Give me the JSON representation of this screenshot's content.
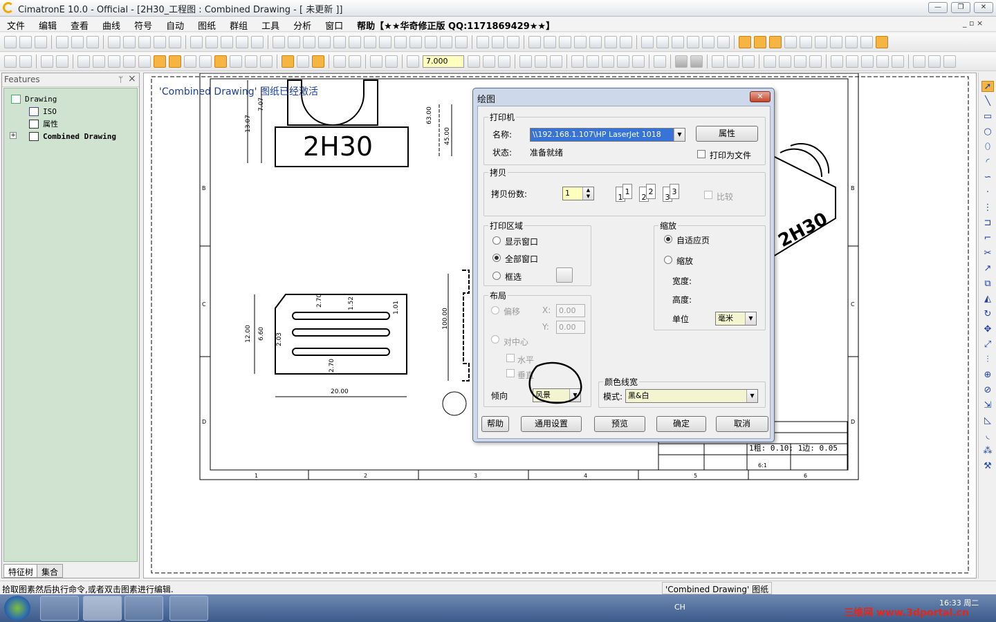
{
  "window": {
    "title": "CimatronE 10.0 - Official - [2H30_工程图 : Combined Drawing - [ 未更新 ]]",
    "min": "—",
    "max": "❐",
    "close": "✕"
  },
  "menubar": {
    "items": [
      "文件",
      "编辑",
      "查看",
      "曲线",
      "符号",
      "自动",
      "图纸",
      "群组",
      "工具",
      "分析",
      "窗口",
      "帮助【★★华奇修正版 QQ:1171869429★★】"
    ],
    "mdi_controls": "_ ▫ ×"
  },
  "toolbar": {
    "zoom_value": "7.000"
  },
  "left_panel": {
    "header": "Features",
    "pin": "ᛘ",
    "close": "×",
    "tree": [
      {
        "label": "Drawing"
      },
      {
        "label": "ISO"
      },
      {
        "label": "属性"
      },
      {
        "label": "Combined Drawing"
      }
    ],
    "expander": "+",
    "tabs": [
      "特征树",
      "集合"
    ]
  },
  "canvas": {
    "message": "'Combined Drawing' 图纸已经激活",
    "part_label": "2H30",
    "iso_label": "2H30",
    "dims": [
      "7.07",
      "13.07",
      "63.00",
      "45.00",
      "12.00",
      "6.60",
      "2.03",
      "2.70",
      "1.52",
      "1.01",
      "2.70",
      "20.00",
      "100.00"
    ],
    "row_labels": [
      "B",
      "C",
      "D"
    ],
    "col_labels": [
      "1",
      "2",
      "3",
      "4",
      "5",
      "6"
    ],
    "title_block_text": "1粗: 0.10; 1边: 0.05",
    "title_block_scale": "6:1"
  },
  "dialog": {
    "title": "绘图",
    "close": "✕",
    "printer": {
      "group": "打印机",
      "name_label": "名称:",
      "name_value": "\\\\192.168.1.107\\HP LaserJet 1018",
      "properties_button": "属性",
      "status_label": "状态:",
      "status_value": "准备就绪",
      "print_to_file": "打印为文件"
    },
    "copies": {
      "group": "拷贝",
      "count_label": "拷贝份数:",
      "count_value": "1",
      "collate": "比较",
      "pages": [
        "1",
        "1",
        "2",
        "2",
        "3",
        "3"
      ]
    },
    "print_area": {
      "group": "打印区域",
      "options": [
        "显示窗口",
        "全部窗口",
        "框选"
      ],
      "selected": "全部窗口"
    },
    "scale": {
      "group": "缩放",
      "options": [
        "自适应页",
        "缩放"
      ],
      "selected": "自适应页",
      "width_label": "宽度:",
      "height_label": "高度:",
      "unit_label": "单位",
      "unit_value": "毫米"
    },
    "layout": {
      "group": "布局",
      "offset": "偏移",
      "x_label": "X:",
      "x_value": "0.00",
      "y_label": "Y:",
      "y_value": "0.00",
      "center": "对中心",
      "horizontal": "水平",
      "vertical": "垂直",
      "orientation_label": "倾向",
      "orientation_value": "风景"
    },
    "color": {
      "group": "颜色线宽",
      "mode_label": "模式:",
      "mode_value": "黑&白"
    },
    "buttons": {
      "help": "帮助",
      "general": "通用设置",
      "preview": "预览",
      "ok": "确定",
      "cancel": "取消"
    }
  },
  "statusbar": {
    "hint": "拾取图素然后执行命令,或者双击图素进行编辑.",
    "sheet": "'Combined Drawing' 图纸"
  },
  "taskbar": {
    "lang": "CH",
    "time": "16:33 周二",
    "watermark": "三维网 www.3dportal.cn"
  }
}
